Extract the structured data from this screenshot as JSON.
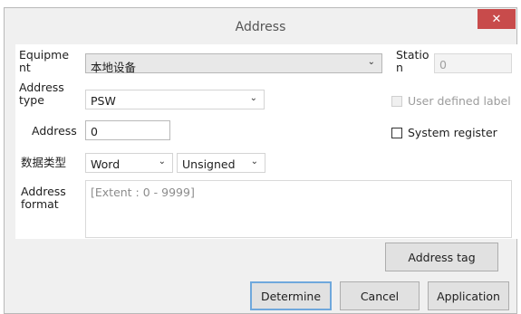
{
  "dialog": {
    "title": "Address",
    "close_glyph": "✕"
  },
  "form": {
    "equipment_label": "Equipme\nnt",
    "equipment_value": "本地设备",
    "station_label": "Statio\nn",
    "station_value": "0",
    "address_type_label": "Address\ntype",
    "address_type_value": "PSW",
    "user_defined_label": "User defined label",
    "user_defined_checked": false,
    "address_label": "Address",
    "address_value": "0",
    "system_register_label": "System register",
    "system_register_checked": false,
    "data_type_label": "数据类型",
    "data_type_value": "Word",
    "sign_value": "Unsigned",
    "address_format_label": "Address\nformat",
    "address_format_value": "[Extent : 0 - 9999]"
  },
  "buttons": {
    "address_tag": "Address tag",
    "determine": "Determine",
    "cancel": "Cancel",
    "application": "Application"
  },
  "icons": {
    "dropdown": "chevron-down-icon",
    "close": "close-icon"
  },
  "colors": {
    "close_button": "#c84b4b",
    "default_button_border": "#6fa8dc"
  }
}
